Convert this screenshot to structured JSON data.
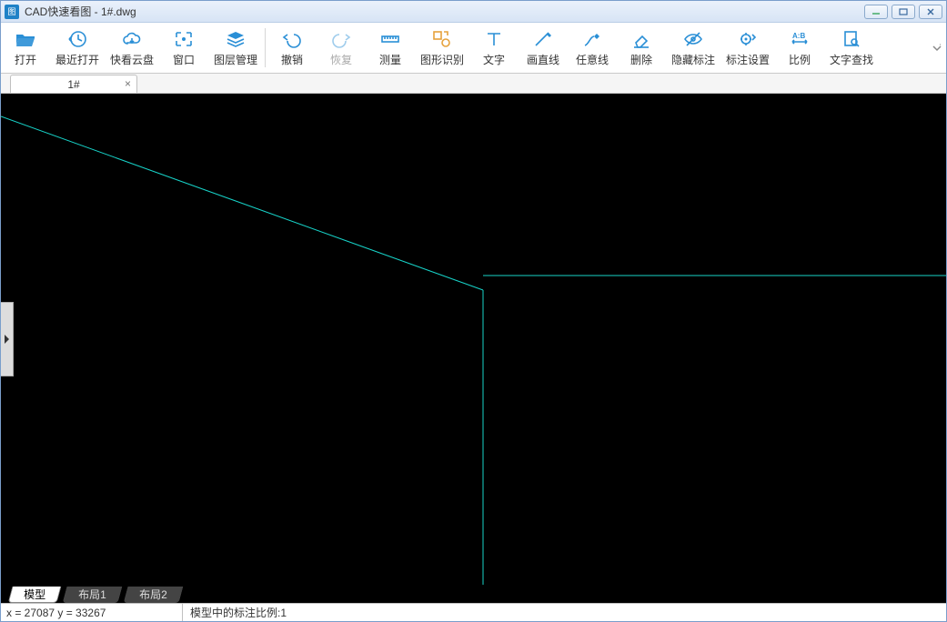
{
  "window": {
    "app_icon_text": "图",
    "title": "CAD快速看图 - 1#.dwg"
  },
  "toolbar": {
    "open": "打开",
    "recent": "最近打开",
    "cloud": "快看云盘",
    "window": "窗口",
    "layers": "图层管理",
    "undo": "撤销",
    "redo": "恢复",
    "measure": "测量",
    "shape_rec": "图形识别",
    "text": "文字",
    "line": "画直线",
    "freeline": "任意线",
    "delete": "删除",
    "hide_annot": "隐藏标注",
    "annot_set": "标注设置",
    "ratio": "比例",
    "text_search": "文字查找"
  },
  "doc_tab": {
    "label": "1#",
    "close": "×"
  },
  "layout_tabs": {
    "model": "模型",
    "layout1": "布局1",
    "layout2": "布局2"
  },
  "status": {
    "coords": "x = 27087 y = 33267",
    "scale": "模型中的标注比例:1"
  },
  "colors": {
    "accent": "#2a8fd6",
    "drawing_line": "#17d3c9"
  }
}
